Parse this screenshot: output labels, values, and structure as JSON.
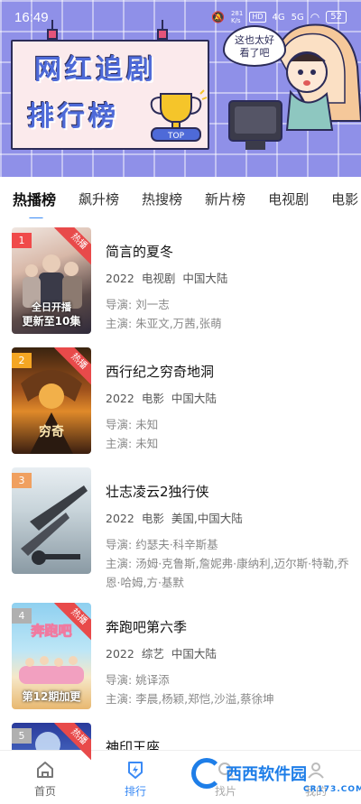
{
  "status_bar": {
    "time": "16:49",
    "network_speed": "281\nK/s",
    "hd_label": "HD",
    "signal_4g": "4G",
    "signal_5g": "5G",
    "battery": "52"
  },
  "banner": {
    "title_line1": "网红追剧",
    "title_line2": "排行榜",
    "trophy_label": "TOP",
    "bubble_text_1": "这也太好",
    "bubble_text_2": "看了吧"
  },
  "tabs": [
    {
      "label": "热播榜",
      "active": true
    },
    {
      "label": "飙升榜",
      "active": false
    },
    {
      "label": "热搜榜",
      "active": false
    },
    {
      "label": "新片榜",
      "active": false
    },
    {
      "label": "电视剧",
      "active": false
    },
    {
      "label": "电影",
      "active": false
    }
  ],
  "list": [
    {
      "rank": "1",
      "rank_color": "#f04a4a",
      "hot": "热播",
      "episode": "更新至10集",
      "poster_overlay": "全日开播",
      "title": "简言的夏冬",
      "year": "2022",
      "type": "电视剧",
      "region": "中国大陆",
      "director_label": "导演:",
      "director": "刘一志",
      "cast_label": "主演:",
      "cast": "朱亚文,万茜,张萌"
    },
    {
      "rank": "2",
      "rank_color": "#f5a623",
      "hot": "热播",
      "episode": "",
      "poster_overlay": "",
      "title": "西行纪之穷奇地洞",
      "year": "2022",
      "type": "电影",
      "region": "中国大陆",
      "director_label": "导演:",
      "director": "未知",
      "cast_label": "主演:",
      "cast": "未知"
    },
    {
      "rank": "3",
      "rank_color": "#f0a060",
      "hot": "",
      "episode": "",
      "poster_overlay": "",
      "title": "壮志凌云2独行侠",
      "year": "2022",
      "type": "电影",
      "region": "美国,中国大陆",
      "director_label": "导演:",
      "director": "约瑟夫·科辛斯基",
      "cast_label": "主演:",
      "cast": "汤姆·克鲁斯,詹妮弗·康纳利,迈尔斯·特勒,乔恩·哈姆,方·基默"
    },
    {
      "rank": "4",
      "rank_color": "#b0b0b0",
      "hot": "热播",
      "episode": "第12期加更",
      "poster_overlay": "",
      "title": "奔跑吧第六季",
      "year": "2022",
      "type": "综艺",
      "region": "中国大陆",
      "director_label": "导演:",
      "director": "姚译添",
      "cast_label": "主演:",
      "cast": "李晨,杨颖,郑恺,沙溢,蔡徐坤"
    },
    {
      "rank": "5",
      "rank_color": "#b0b0b0",
      "hot": "热播",
      "episode": "",
      "poster_overlay": "",
      "title": "神印王座",
      "year": "",
      "type": "",
      "region": "",
      "director_label": "",
      "director": "",
      "cast_label": "",
      "cast": ""
    }
  ],
  "bottom_nav": [
    {
      "label": "首页",
      "icon": "home-icon",
      "active": false
    },
    {
      "label": "排行",
      "icon": "ranking-icon",
      "active": true
    },
    {
      "label": "找片",
      "icon": "search-icon",
      "active": false
    },
    {
      "label": "我的",
      "icon": "profile-icon",
      "active": false
    }
  ],
  "watermark": {
    "text": "西西软件园",
    "sub": "CR173.COM"
  },
  "colors": {
    "accent": "#3a8af5",
    "banner_bg": "#8f90e8",
    "hot_badge": "#e84a4a"
  }
}
